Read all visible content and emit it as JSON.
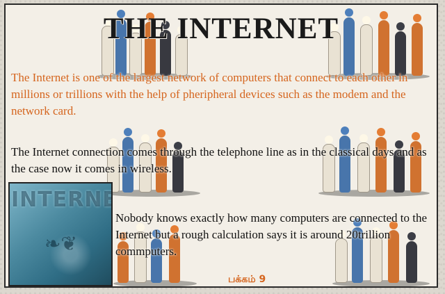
{
  "title": "THE INTERNET",
  "paragraphs": [
    "The Internet is one of the largest network of computers that connect to each other in millions or trillions with the help of pheripheral devices such as the modem and the network card.",
    "The Internet connection comes through the telephone line as in the classical days and as the case now it comes in wireless.",
    "Nobody knows exactly how many computers are connected to the Internet but a rough calculation says it is around 20trillion commputers."
  ],
  "image": {
    "text": "INTERNET"
  },
  "page_number": "பக்கம் 9",
  "colors": {
    "accent": "#d5651e",
    "text": "#111111",
    "paper": "#f3efe7"
  }
}
